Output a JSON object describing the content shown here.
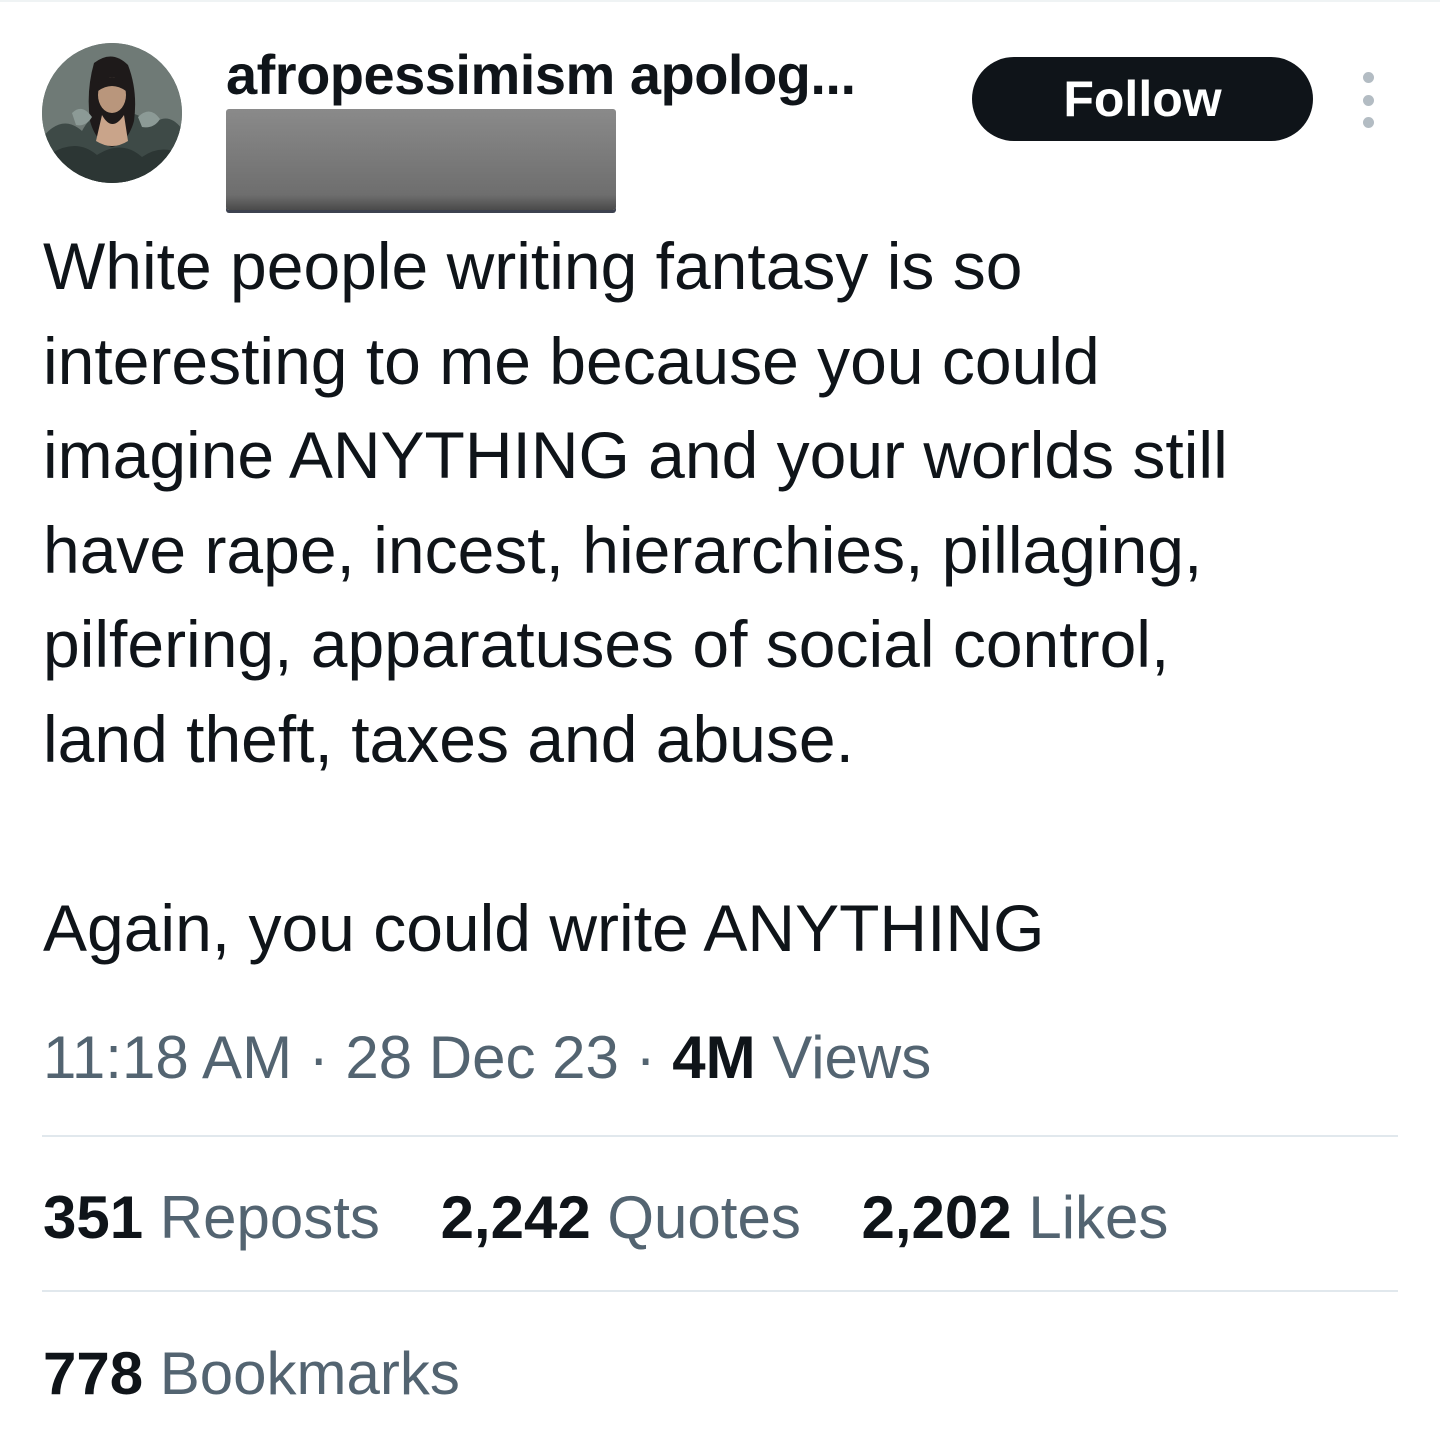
{
  "tweet": {
    "author": {
      "display_name": "afropessimism apolog...",
      "handle_redacted": true
    },
    "follow_label": "Follow",
    "more_icon": "more-vertical-icon",
    "text_lines": [
      "White people writing fantasy is so",
      "interesting to me because you could",
      "imagine ANYTHING and your worlds still",
      "have rape, incest, hierarchies, pillaging,",
      "pilfering, apparatuses of social control,",
      "land theft, taxes and abuse.",
      "",
      "Again, you could write ANYTHING"
    ],
    "meta": {
      "time": "11:18 AM",
      "separator": "·",
      "date": "28 Dec 23",
      "views_count": "4M",
      "views_label": "Views"
    },
    "stats": {
      "reposts_count": "351",
      "reposts_label": "Reposts",
      "quotes_count": "2,242",
      "quotes_label": "Quotes",
      "likes_count": "2,202",
      "likes_label": "Likes"
    },
    "bookmarks": {
      "count": "778",
      "label": "Bookmarks"
    }
  },
  "colors": {
    "text_primary": "#0f1419",
    "text_secondary": "#536471",
    "follow_bg": "#0f1419",
    "divider": "#e1e8ed"
  }
}
